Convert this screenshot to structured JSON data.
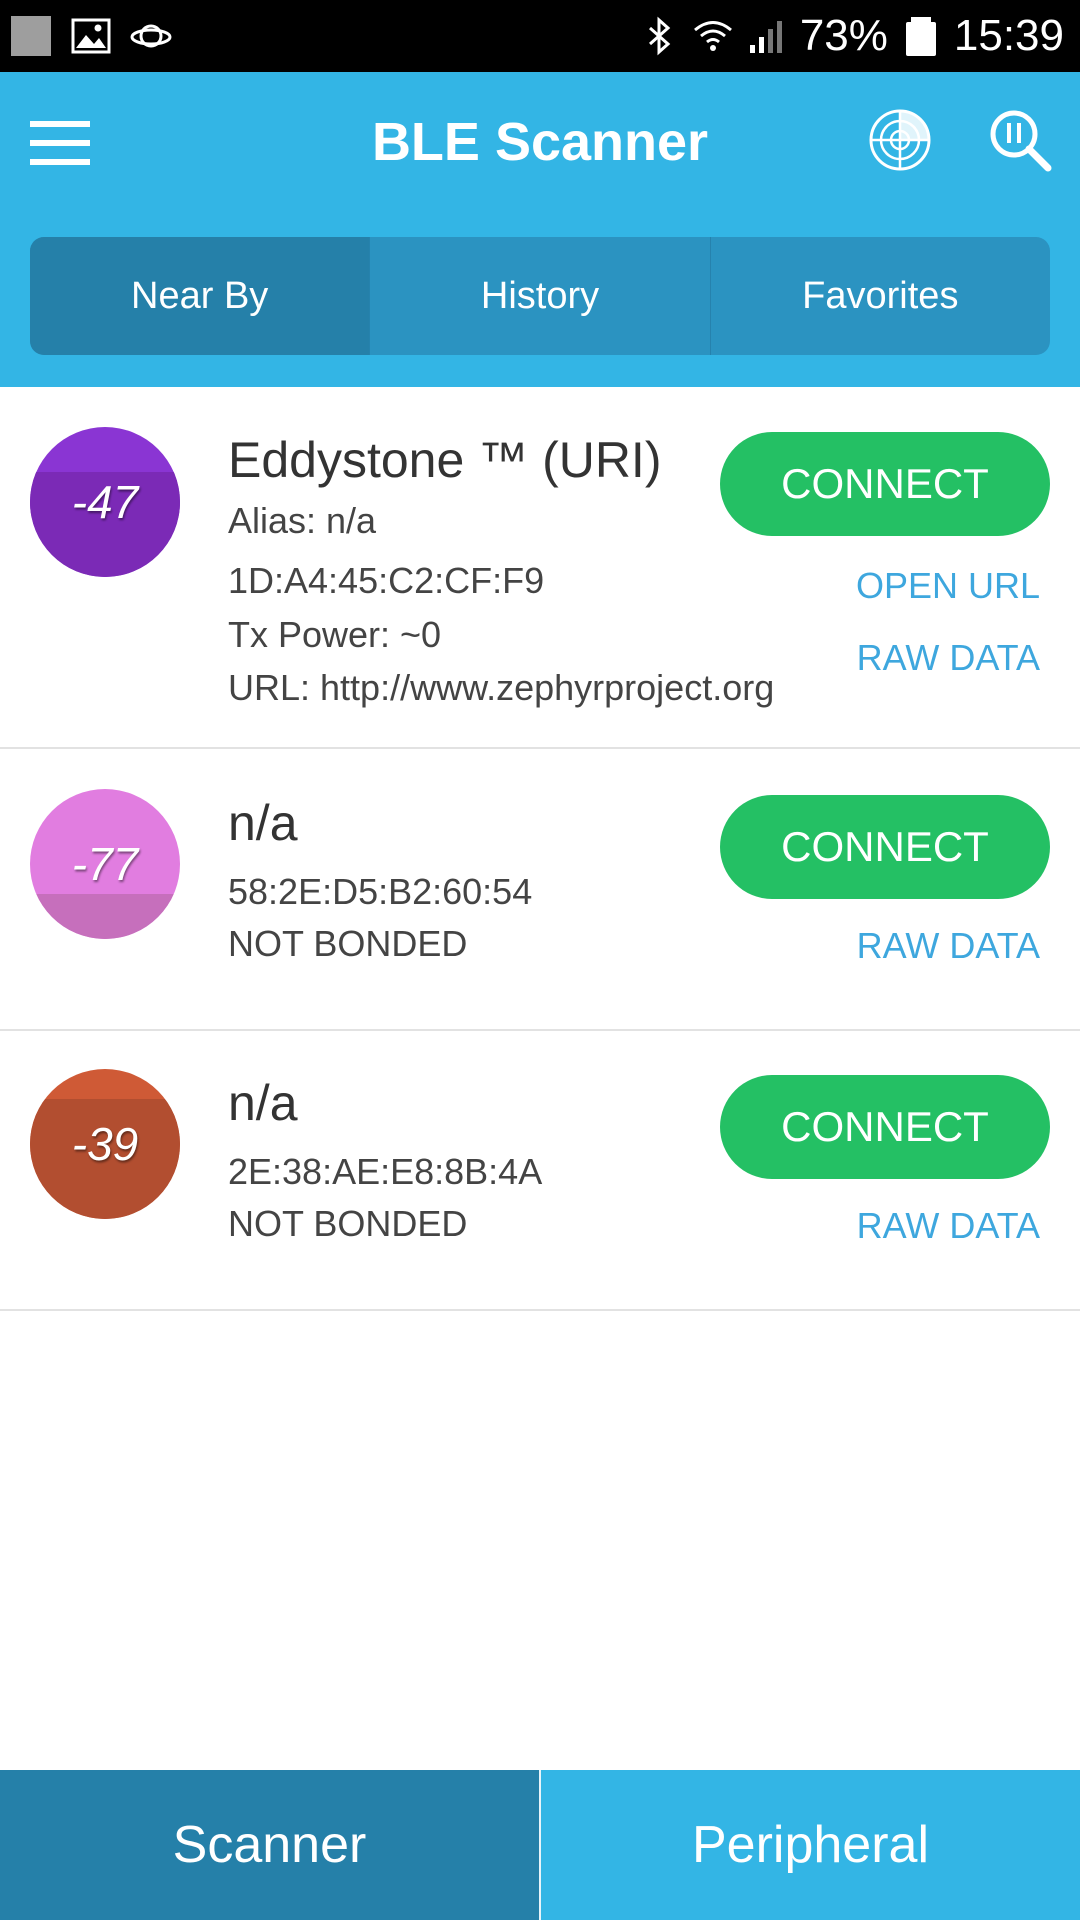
{
  "status_bar": {
    "battery": "73%",
    "time": "15:39"
  },
  "app": {
    "title": "BLE Scanner",
    "tabs": [
      "Near By",
      "History",
      "Favorites"
    ]
  },
  "devices": [
    {
      "rssi": "-47",
      "name": "Eddystone ™ (URI)",
      "alias": "Alias: n/a",
      "address": "1D:A4:45:C2:CF:F9",
      "tx_power": "Tx Power: ~0",
      "url": "URL: http://www.zephyrproject.org",
      "connect_label": "CONNECT",
      "open_url_label": "OPEN URL",
      "raw_data_label": "RAW DATA",
      "color_top": "#8a35d3",
      "color_bottom": "#7b2ab6"
    },
    {
      "rssi": "-77",
      "name": "n/a",
      "address": "58:2E:D5:B2:60:54",
      "bond": "NOT BONDED",
      "connect_label": "CONNECT",
      "raw_data_label": "RAW DATA",
      "color_top": "#e17de0",
      "color_bottom": "#c66fbc"
    },
    {
      "rssi": "-39",
      "name": "n/a",
      "address": "2E:38:AE:E8:8B:4A",
      "bond": "NOT BONDED",
      "connect_label": "CONNECT",
      "raw_data_label": "RAW DATA",
      "color_top": "#cf5a36",
      "color_bottom": "#b24e30"
    }
  ],
  "bottom_nav": {
    "scanner": "Scanner",
    "peripheral": "Peripheral"
  }
}
